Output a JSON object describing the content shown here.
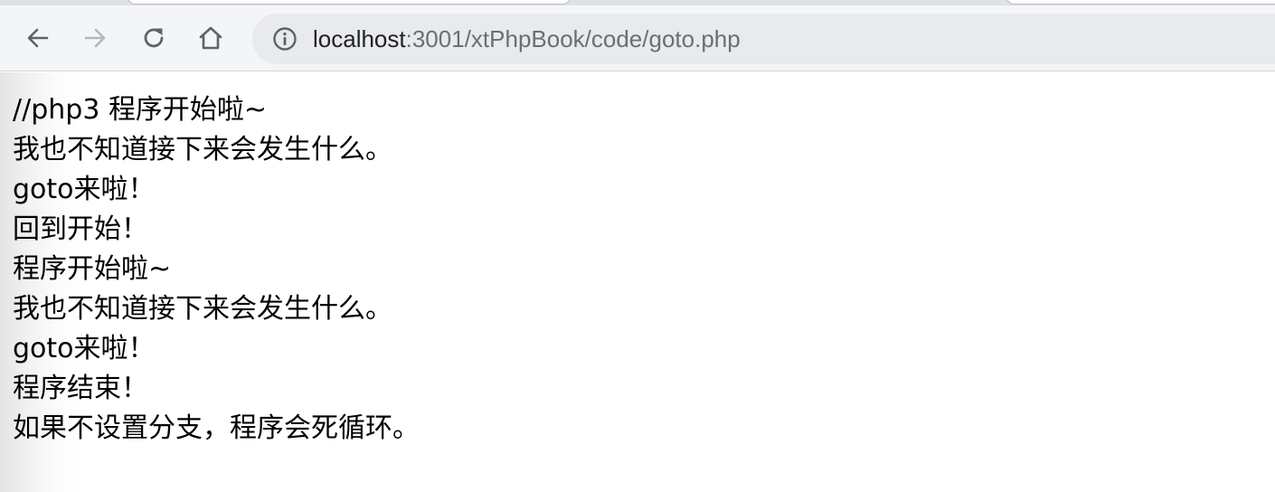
{
  "browser": {
    "url_host": "localhost",
    "url_path": ":3001/xtPhpBook/code/goto.php",
    "colors": {
      "toolbar_bg": "#f4f5f7",
      "omnibox_bg": "#e9eaed",
      "icon_active": "#5f6368",
      "icon_disabled": "#b4b7bb"
    },
    "icons": [
      "back-arrow-icon",
      "forward-arrow-icon",
      "reload-icon",
      "home-icon",
      "info-icon"
    ]
  },
  "page": {
    "lines": [
      "//php3 程序开始啦~",
      "我也不知道接下来会发生什么。",
      "goto来啦！",
      "回到开始！",
      "程序开始啦~",
      "我也不知道接下来会发生什么。",
      "goto来啦！",
      "程序结束！",
      "如果不设置分支，程序会死循环。"
    ]
  }
}
